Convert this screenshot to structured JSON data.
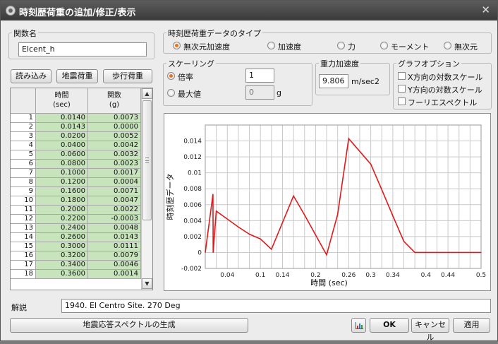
{
  "window": {
    "title": "時刻歴荷重の追加/修正/表示",
    "close_glyph": "✕"
  },
  "func_name": {
    "label": "関数名",
    "value": "Elcent_h"
  },
  "buttons": {
    "load": "読み込み",
    "seismic": "地震荷重",
    "walking": "歩行荷重",
    "generate": "地震応答スペクトルの生成",
    "ok": "OK",
    "cancel": "キャンセル",
    "apply": "適用"
  },
  "table": {
    "headers": {
      "time": "時間",
      "time_unit": "(sec)",
      "func": "関数",
      "func_unit": "(g)"
    },
    "rows": [
      {
        "no": "1",
        "time": "0.0140",
        "value": "0.0073"
      },
      {
        "no": "2",
        "time": "0.0143",
        "value": "0.0000"
      },
      {
        "no": "3",
        "time": "0.0200",
        "value": "0.0052"
      },
      {
        "no": "4",
        "time": "0.0400",
        "value": "0.0042"
      },
      {
        "no": "5",
        "time": "0.0600",
        "value": "0.0032"
      },
      {
        "no": "6",
        "time": "0.0800",
        "value": "0.0023"
      },
      {
        "no": "7",
        "time": "0.1000",
        "value": "0.0017"
      },
      {
        "no": "8",
        "time": "0.1200",
        "value": "0.0004"
      },
      {
        "no": "9",
        "time": "0.1600",
        "value": "0.0071"
      },
      {
        "no": "10",
        "time": "0.1800",
        "value": "0.0047"
      },
      {
        "no": "11",
        "time": "0.2000",
        "value": "0.0022"
      },
      {
        "no": "12",
        "time": "0.2200",
        "value": "-0.0003"
      },
      {
        "no": "13",
        "time": "0.2400",
        "value": "0.0048"
      },
      {
        "no": "14",
        "time": "0.2600",
        "value": "0.0143"
      },
      {
        "no": "15",
        "time": "0.3000",
        "value": "0.0111"
      },
      {
        "no": "16",
        "time": "0.3200",
        "value": "0.0079"
      },
      {
        "no": "17",
        "time": "0.3400",
        "value": "0.0046"
      },
      {
        "no": "18",
        "time": "0.3600",
        "value": "0.0014"
      }
    ]
  },
  "data_type": {
    "label": "時刻歴荷重データのタイプ",
    "options": [
      "無次元加速度",
      "加速度",
      "力",
      "モーメント",
      "無次元"
    ],
    "selected": "無次元加速度"
  },
  "scaling": {
    "label": "スケーリング",
    "factor_label": "倍率",
    "factor_value": "1",
    "max_label": "最大値",
    "max_value": "0",
    "max_unit": "g",
    "selected": "倍率"
  },
  "gravity": {
    "label": "重力加速度",
    "value": "9.806",
    "unit": "m/sec2"
  },
  "graph_options": {
    "label": "グラフオプション",
    "x_log": "X方向の対数スケール",
    "y_log": "Y方向の対数スケール",
    "fourier": "フーリエスペクトル"
  },
  "description": {
    "label": "解説",
    "value": "1940. El Centro Site. 270 Deg"
  },
  "icons": {
    "window": "window-icon",
    "close": "close-icon",
    "chart_btn": "chart-icon"
  },
  "colors": {
    "series": "#e0191b",
    "grid": "#c9c9c9",
    "row_value_bg": "#c8e4bd",
    "radio_selected": "#e8731f"
  },
  "chart_data": {
    "type": "line",
    "xlabel": "時間 (sec)",
    "ylabel": "時刻歴データ",
    "xlim": [
      0,
      0.5
    ],
    "ylim": [
      -0.002,
      0.016
    ],
    "x_ticks": [
      "0.04",
      "0.1",
      "0.14",
      "0.2",
      "0.26",
      "0.3",
      "0.34",
      "0.4",
      "0.44",
      "0.5"
    ],
    "x_tick_values": [
      0.04,
      0.1,
      0.14,
      0.2,
      0.26,
      0.3,
      0.34,
      0.4,
      0.44,
      0.5
    ],
    "y_ticks": [
      "0.014",
      "0.012",
      "0.01",
      "0.008",
      "0.006",
      "0.004",
      "0.002",
      "0",
      "-0.002"
    ],
    "y_tick_values": [
      0.014,
      0.012,
      0.01,
      0.008,
      0.006,
      0.004,
      0.002,
      0,
      -0.002
    ],
    "grid": true,
    "series": [
      {
        "x": [
          0,
          0.014,
          0.0143,
          0.02,
          0.04,
          0.06,
          0.08,
          0.1,
          0.12,
          0.16,
          0.18,
          0.2,
          0.22,
          0.24,
          0.26,
          0.3,
          0.32,
          0.34,
          0.36,
          0.38,
          0.4,
          0.42,
          0.44,
          0.46,
          0.48,
          0.5
        ],
        "y": [
          0,
          0.0073,
          0.0,
          0.0052,
          0.0042,
          0.0032,
          0.0023,
          0.0017,
          0.0004,
          0.0071,
          0.0047,
          0.0022,
          -0.0003,
          0.0048,
          0.0143,
          0.0111,
          0.0079,
          0.0046,
          0.0014,
          0,
          0,
          0,
          0,
          0,
          0,
          0
        ]
      }
    ]
  }
}
